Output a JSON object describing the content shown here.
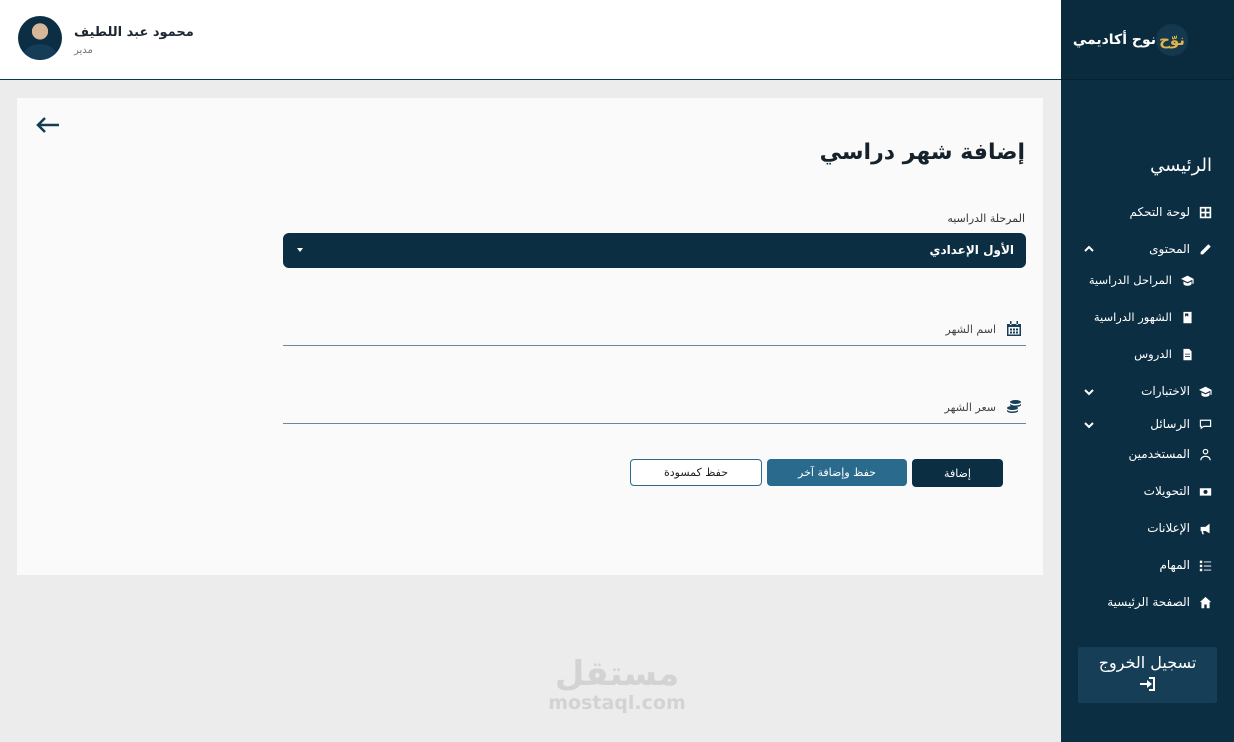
{
  "header": {
    "user_name": "محمود عبد اللطيف",
    "user_role": "مدير"
  },
  "sidebar": {
    "brand": {
      "logo_text": "نوّح",
      "name": "نوح أكاديمي"
    },
    "section_title": "الرئيسي",
    "items": [
      {
        "label": "لوحة التحكم",
        "icon": "grid-icon"
      },
      {
        "label": "المحتوى",
        "icon": "pencil-icon",
        "chevron": "up"
      },
      {
        "label": "المراحل الدراسية",
        "icon": "graduation-cap-icon"
      },
      {
        "label": "الشهور الدراسية",
        "icon": "book-icon"
      },
      {
        "label": "الدروس",
        "icon": "file-icon"
      },
      {
        "label": "الاختبارات",
        "icon": "graduation-cap-icon",
        "chevron": "down"
      },
      {
        "label": "الرسائل",
        "icon": "chat-icon",
        "chevron": "down"
      },
      {
        "label": "المستخدمين",
        "icon": "user-icon"
      },
      {
        "label": "التحويلات",
        "icon": "money-icon"
      },
      {
        "label": "الإعلانات",
        "icon": "megaphone-icon"
      },
      {
        "label": "المهام",
        "icon": "tasks-icon"
      },
      {
        "label": "الصفحة الرئيسية",
        "icon": "home-icon"
      }
    ],
    "logout_label": "تسجيل الخروج"
  },
  "form": {
    "title": "إضافة شهر دراسي",
    "stage_label": "المرحلة الدراسيه",
    "stage_value": "الأول الإعدادي",
    "month_name_placeholder": "اسم الشهر",
    "month_price_placeholder": "سعر الشهر",
    "buttons": {
      "add": "إضافة",
      "save_and_add": "حفظ وإضافة آخر",
      "save_draft": "حفظ كمسودة"
    }
  },
  "watermark": {
    "arabic": "مستقل",
    "latin": "mostaql.com"
  },
  "colors": {
    "primary": "#0b2e42",
    "secondary": "#2a6a8c",
    "background": "#ececec",
    "card": "#fafafa"
  }
}
